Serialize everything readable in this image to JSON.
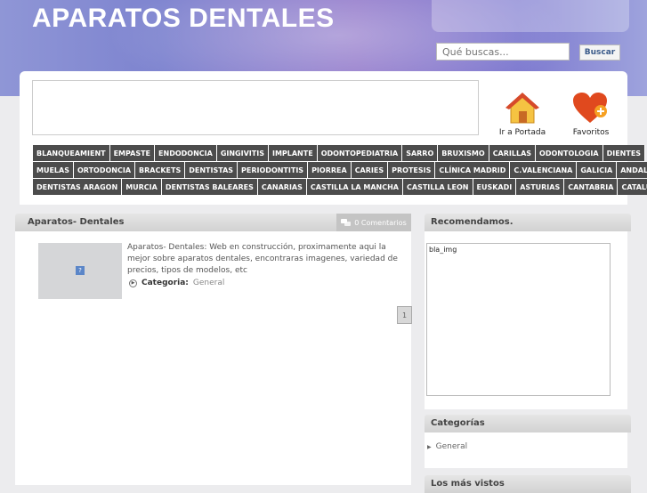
{
  "header": {
    "site_title": "APARATOS DENTALES",
    "search_placeholder": "Qué buscas...",
    "search_button": "Buscar",
    "home_label": "Ir a Portada",
    "favorites_label": "Favoritos"
  },
  "nav": {
    "rows": [
      [
        "BLANQUEAMIENT",
        "EMPASTE",
        "ENDODONCIA",
        "GINGIVITIS",
        "IMPLANTE",
        "ODONTOPEDIATRIA",
        "SARRO",
        "BRUXISMO",
        "CARILLAS",
        "ODONTOLOGIA",
        "DIENTES"
      ],
      [
        "MUELAS",
        "ORTODONCIA",
        "BRACKETS",
        "DENTISTAS",
        "PERIODONTITIS",
        "PIORREA",
        "CARIES",
        "PROTESIS",
        "CLÍNICA MADRID",
        "C.VALENCIANA",
        "GALICIA",
        "ANDALUCIA"
      ],
      [
        "DENTISTAS ARAGON",
        "MURCIA",
        "DENTISTAS BALEARES",
        "CANARIAS",
        "CASTILLA LA MANCHA",
        "CASTILLA LEON",
        "EUSKADI",
        "ASTURIAS",
        "CANTABRIA",
        "CATALUNYA"
      ]
    ]
  },
  "post": {
    "title": "Aparatos- Dentales",
    "comments": "0 Comentarios",
    "excerpt": "Aparatos- Dentales: Web en construcción, proximamente aqui la mejor sobre aparatos dentales, encontraras imagenes, variedad de precios, tipos de modelos, etc",
    "category_label": "Categoria:",
    "category_value": "General",
    "thumb_glyph": "?",
    "page_number": "1"
  },
  "sidebar": {
    "recommend_title": "Recomendamos.",
    "ad_alt": "bla_img",
    "categories_title": "Categorías",
    "categories": [
      "General"
    ],
    "most_viewed_title": "Los más vistos"
  }
}
